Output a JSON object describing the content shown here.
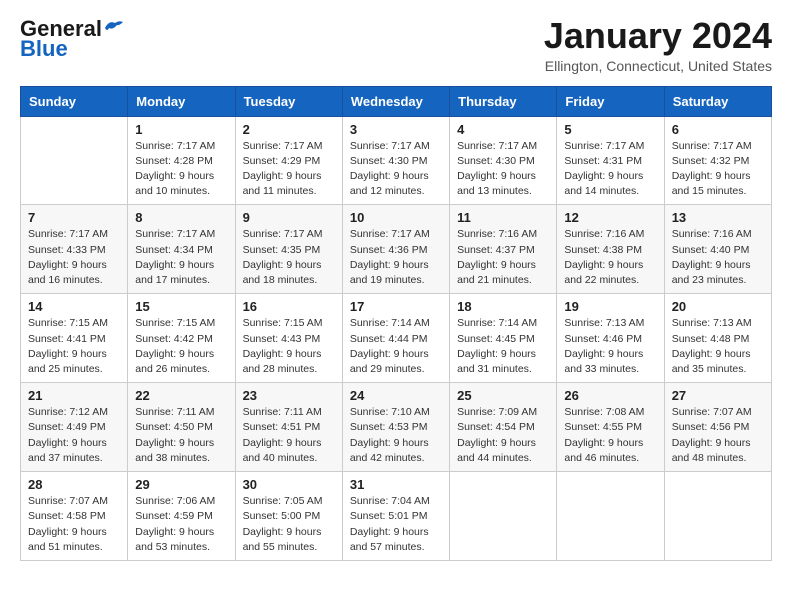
{
  "header": {
    "logo_general": "General",
    "logo_blue": "Blue",
    "title": "January 2024",
    "location": "Ellington, Connecticut, United States"
  },
  "days_of_week": [
    "Sunday",
    "Monday",
    "Tuesday",
    "Wednesday",
    "Thursday",
    "Friday",
    "Saturday"
  ],
  "weeks": [
    [
      {
        "day": "",
        "sunrise": "",
        "sunset": "",
        "daylight": ""
      },
      {
        "day": "1",
        "sunrise": "Sunrise: 7:17 AM",
        "sunset": "Sunset: 4:28 PM",
        "daylight": "Daylight: 9 hours and 10 minutes."
      },
      {
        "day": "2",
        "sunrise": "Sunrise: 7:17 AM",
        "sunset": "Sunset: 4:29 PM",
        "daylight": "Daylight: 9 hours and 11 minutes."
      },
      {
        "day": "3",
        "sunrise": "Sunrise: 7:17 AM",
        "sunset": "Sunset: 4:30 PM",
        "daylight": "Daylight: 9 hours and 12 minutes."
      },
      {
        "day": "4",
        "sunrise": "Sunrise: 7:17 AM",
        "sunset": "Sunset: 4:30 PM",
        "daylight": "Daylight: 9 hours and 13 minutes."
      },
      {
        "day": "5",
        "sunrise": "Sunrise: 7:17 AM",
        "sunset": "Sunset: 4:31 PM",
        "daylight": "Daylight: 9 hours and 14 minutes."
      },
      {
        "day": "6",
        "sunrise": "Sunrise: 7:17 AM",
        "sunset": "Sunset: 4:32 PM",
        "daylight": "Daylight: 9 hours and 15 minutes."
      }
    ],
    [
      {
        "day": "7",
        "sunrise": "Sunrise: 7:17 AM",
        "sunset": "Sunset: 4:33 PM",
        "daylight": "Daylight: 9 hours and 16 minutes."
      },
      {
        "day": "8",
        "sunrise": "Sunrise: 7:17 AM",
        "sunset": "Sunset: 4:34 PM",
        "daylight": "Daylight: 9 hours and 17 minutes."
      },
      {
        "day": "9",
        "sunrise": "Sunrise: 7:17 AM",
        "sunset": "Sunset: 4:35 PM",
        "daylight": "Daylight: 9 hours and 18 minutes."
      },
      {
        "day": "10",
        "sunrise": "Sunrise: 7:17 AM",
        "sunset": "Sunset: 4:36 PM",
        "daylight": "Daylight: 9 hours and 19 minutes."
      },
      {
        "day": "11",
        "sunrise": "Sunrise: 7:16 AM",
        "sunset": "Sunset: 4:37 PM",
        "daylight": "Daylight: 9 hours and 21 minutes."
      },
      {
        "day": "12",
        "sunrise": "Sunrise: 7:16 AM",
        "sunset": "Sunset: 4:38 PM",
        "daylight": "Daylight: 9 hours and 22 minutes."
      },
      {
        "day": "13",
        "sunrise": "Sunrise: 7:16 AM",
        "sunset": "Sunset: 4:40 PM",
        "daylight": "Daylight: 9 hours and 23 minutes."
      }
    ],
    [
      {
        "day": "14",
        "sunrise": "Sunrise: 7:15 AM",
        "sunset": "Sunset: 4:41 PM",
        "daylight": "Daylight: 9 hours and 25 minutes."
      },
      {
        "day": "15",
        "sunrise": "Sunrise: 7:15 AM",
        "sunset": "Sunset: 4:42 PM",
        "daylight": "Daylight: 9 hours and 26 minutes."
      },
      {
        "day": "16",
        "sunrise": "Sunrise: 7:15 AM",
        "sunset": "Sunset: 4:43 PM",
        "daylight": "Daylight: 9 hours and 28 minutes."
      },
      {
        "day": "17",
        "sunrise": "Sunrise: 7:14 AM",
        "sunset": "Sunset: 4:44 PM",
        "daylight": "Daylight: 9 hours and 29 minutes."
      },
      {
        "day": "18",
        "sunrise": "Sunrise: 7:14 AM",
        "sunset": "Sunset: 4:45 PM",
        "daylight": "Daylight: 9 hours and 31 minutes."
      },
      {
        "day": "19",
        "sunrise": "Sunrise: 7:13 AM",
        "sunset": "Sunset: 4:46 PM",
        "daylight": "Daylight: 9 hours and 33 minutes."
      },
      {
        "day": "20",
        "sunrise": "Sunrise: 7:13 AM",
        "sunset": "Sunset: 4:48 PM",
        "daylight": "Daylight: 9 hours and 35 minutes."
      }
    ],
    [
      {
        "day": "21",
        "sunrise": "Sunrise: 7:12 AM",
        "sunset": "Sunset: 4:49 PM",
        "daylight": "Daylight: 9 hours and 37 minutes."
      },
      {
        "day": "22",
        "sunrise": "Sunrise: 7:11 AM",
        "sunset": "Sunset: 4:50 PM",
        "daylight": "Daylight: 9 hours and 38 minutes."
      },
      {
        "day": "23",
        "sunrise": "Sunrise: 7:11 AM",
        "sunset": "Sunset: 4:51 PM",
        "daylight": "Daylight: 9 hours and 40 minutes."
      },
      {
        "day": "24",
        "sunrise": "Sunrise: 7:10 AM",
        "sunset": "Sunset: 4:53 PM",
        "daylight": "Daylight: 9 hours and 42 minutes."
      },
      {
        "day": "25",
        "sunrise": "Sunrise: 7:09 AM",
        "sunset": "Sunset: 4:54 PM",
        "daylight": "Daylight: 9 hours and 44 minutes."
      },
      {
        "day": "26",
        "sunrise": "Sunrise: 7:08 AM",
        "sunset": "Sunset: 4:55 PM",
        "daylight": "Daylight: 9 hours and 46 minutes."
      },
      {
        "day": "27",
        "sunrise": "Sunrise: 7:07 AM",
        "sunset": "Sunset: 4:56 PM",
        "daylight": "Daylight: 9 hours and 48 minutes."
      }
    ],
    [
      {
        "day": "28",
        "sunrise": "Sunrise: 7:07 AM",
        "sunset": "Sunset: 4:58 PM",
        "daylight": "Daylight: 9 hours and 51 minutes."
      },
      {
        "day": "29",
        "sunrise": "Sunrise: 7:06 AM",
        "sunset": "Sunset: 4:59 PM",
        "daylight": "Daylight: 9 hours and 53 minutes."
      },
      {
        "day": "30",
        "sunrise": "Sunrise: 7:05 AM",
        "sunset": "Sunset: 5:00 PM",
        "daylight": "Daylight: 9 hours and 55 minutes."
      },
      {
        "day": "31",
        "sunrise": "Sunrise: 7:04 AM",
        "sunset": "Sunset: 5:01 PM",
        "daylight": "Daylight: 9 hours and 57 minutes."
      },
      {
        "day": "",
        "sunrise": "",
        "sunset": "",
        "daylight": ""
      },
      {
        "day": "",
        "sunrise": "",
        "sunset": "",
        "daylight": ""
      },
      {
        "day": "",
        "sunrise": "",
        "sunset": "",
        "daylight": ""
      }
    ]
  ]
}
